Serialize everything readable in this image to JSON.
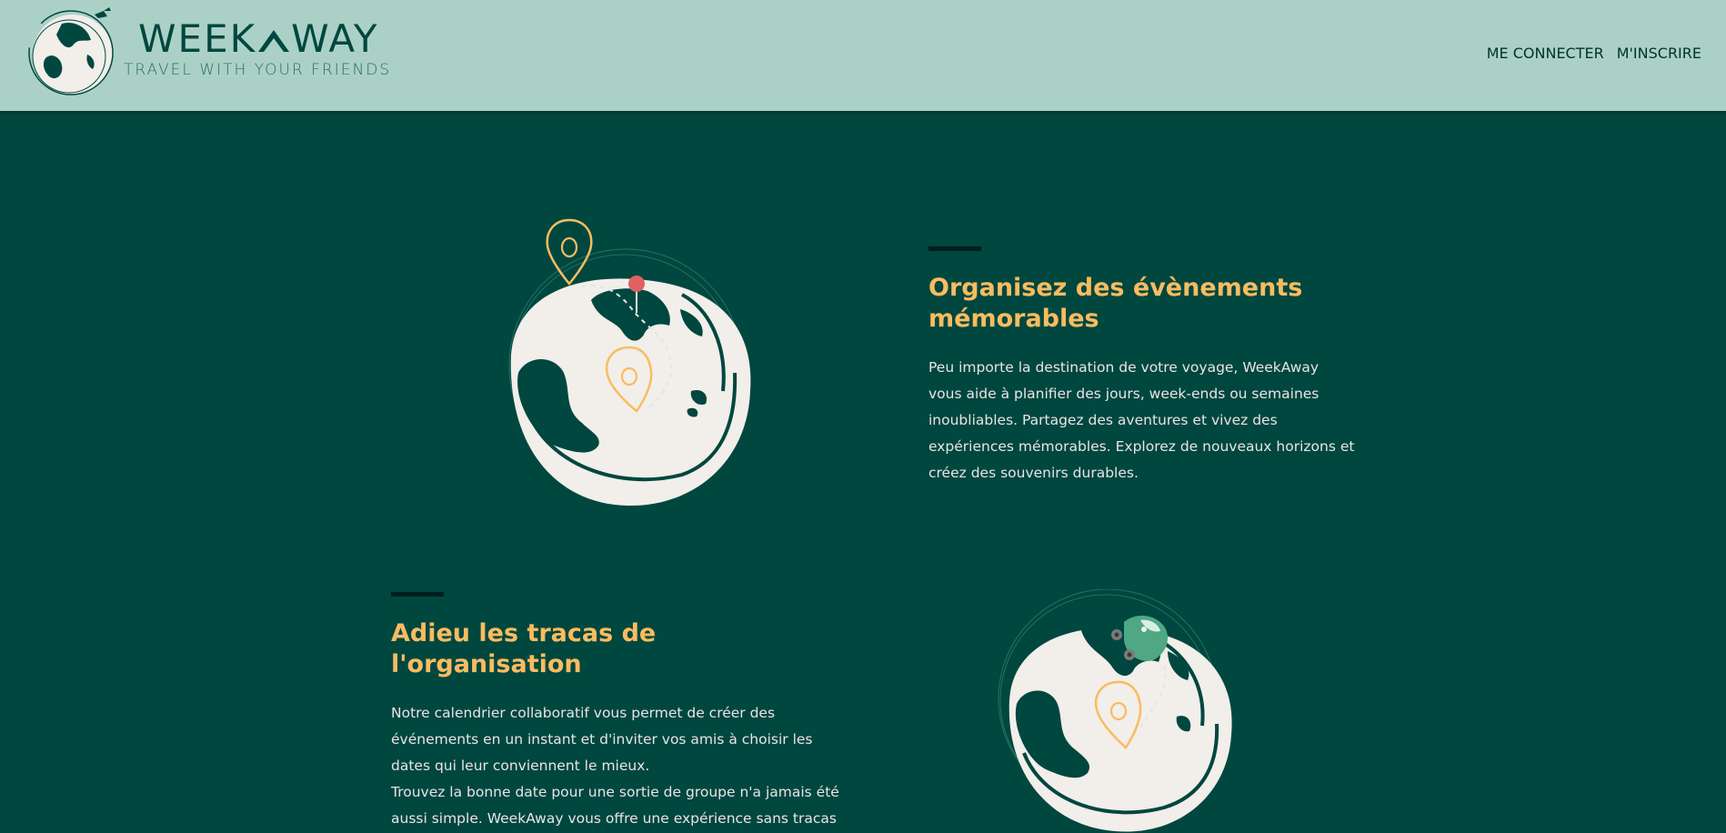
{
  "brand": {
    "name_left": "WEEK",
    "name_right": "WAY",
    "tagline": "TRAVEL WITH YOUR FRIENDS",
    "logo_icon": "globe-airplane-logo"
  },
  "nav": {
    "login": "ME CONNECTER",
    "signup": "M'INSCRIRE"
  },
  "features": [
    {
      "title": "Organisez des évènements mémorables",
      "body": "Peu importe la destination de votre voyage, WeekAway vous aide à planifier des jours, week-ends ou semaines inoubliables. Partagez des aventures et vivez des expériences mémorables. Explorez de nouveaux horizons et créez des souvenirs durables.",
      "illustration": "globe-map-pins-illustration"
    },
    {
      "title": "Adieu les tracas de l'organisation",
      "body": "Notre calendrier collaboratif vous permet de créer des événements en un instant et d'inviter vos amis à choisir les dates qui leur conviennent le mieux.\nTrouvez la bonne date pour une sortie de groupe n'a jamais été aussi simple. WeekAway vous offre une expérience sans tracas",
      "illustration": "globe-car-illustration"
    }
  ],
  "colors": {
    "background": "#00473f",
    "header": "#abd1c6",
    "accent": "#f9bc60",
    "text": "#e8e4e6",
    "globe": "#f2eeea",
    "pin_red": "#e16162"
  }
}
